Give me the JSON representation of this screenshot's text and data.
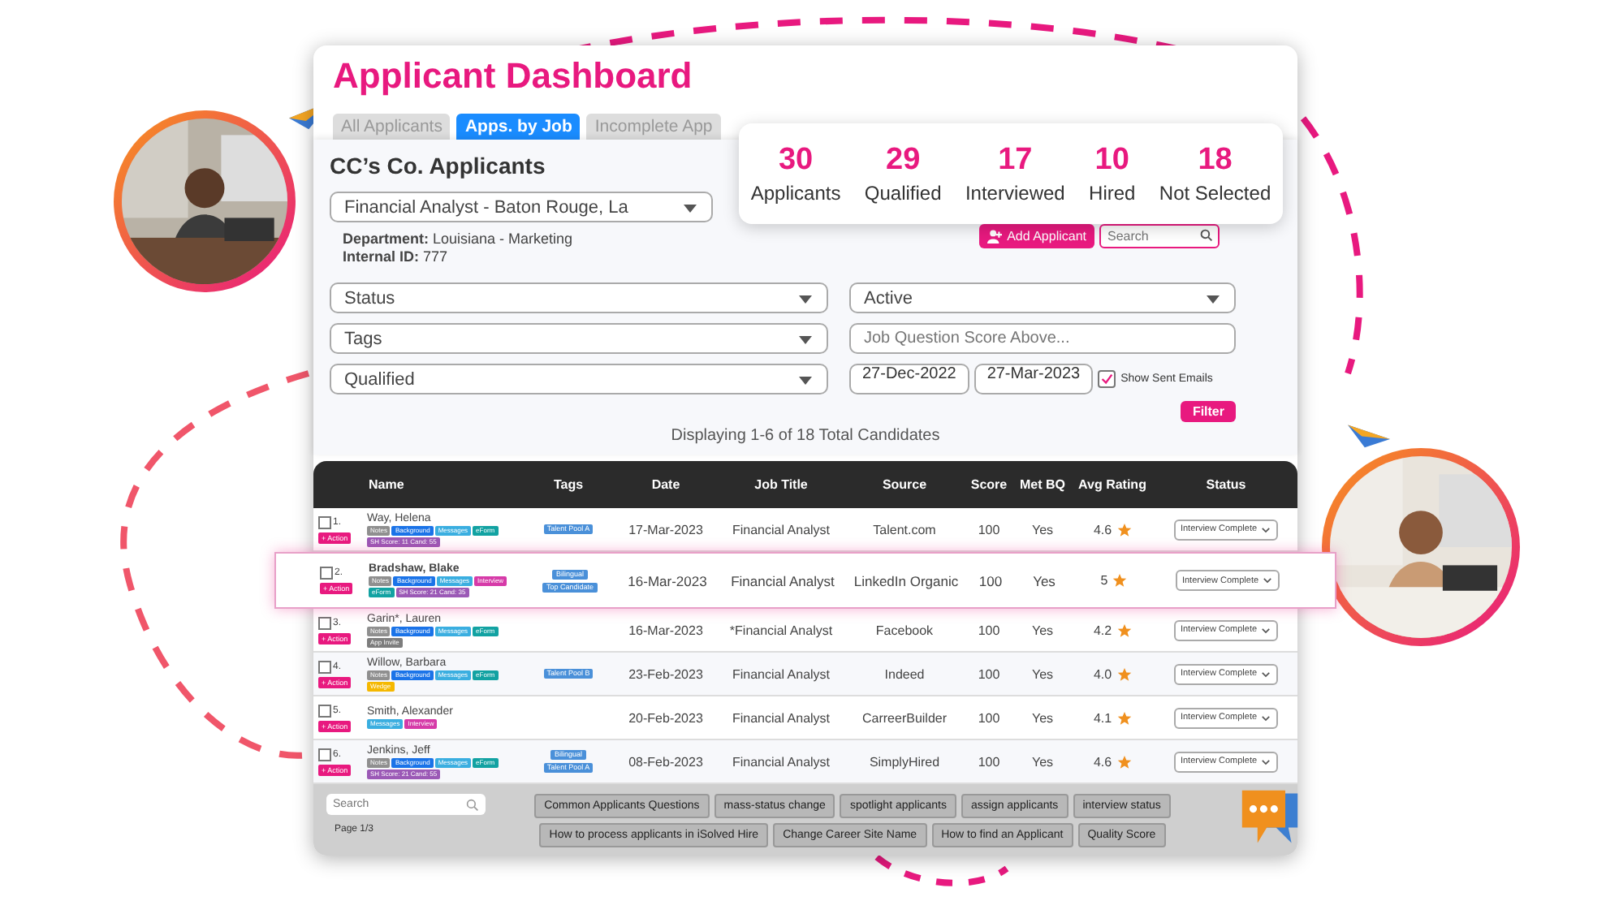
{
  "window": {
    "title": "Applicant Dashboard"
  },
  "tabs": [
    {
      "label": "All Applicants",
      "selected": false
    },
    {
      "label": "Apps. by Job",
      "selected": true
    },
    {
      "label": "Incomplete App",
      "selected": false
    }
  ],
  "stats": [
    {
      "value": "30",
      "label": "Applicants"
    },
    {
      "value": "29",
      "label": "Qualified"
    },
    {
      "value": "17",
      "label": "Interviewed"
    },
    {
      "value": "10",
      "label": "Hired"
    },
    {
      "value": "18",
      "label": "Not Selected"
    }
  ],
  "panel": {
    "title": "CC’s Co. Applicants",
    "job_select": "Financial Analyst - Baton Rouge, La",
    "department": "**Department:** Louisiana -  Marketing",
    "internal_id": "**Internal ID:** 777",
    "add_button": "Add Applicant",
    "search": {
      "placeholder": "Search"
    }
  },
  "filters": {
    "left": [
      "Status",
      "Tags",
      "Qualified"
    ],
    "state_select": "Active",
    "score_field": {
      "placeholder": "Job Question Score Above..."
    },
    "date_from": "27-Dec-2022",
    "date_to": "27-Mar-2023",
    "show_sent_emails": {
      "label": "Show Sent Emails",
      "checked": true
    },
    "filter_button": "Filter"
  },
  "summary": "Displaying 1-6 of 18 Total Candidates",
  "table": {
    "columns": [
      "Name",
      "Tags",
      "Date",
      "Job Title",
      "Source",
      "Score",
      "Met BQ",
      "Avg Rating",
      "Status"
    ],
    "rows": [
      {
        "number": "1.",
        "checked": false,
        "selected": false,
        "action": "+ Action",
        "name": "Way, Helena",
        "badges": [
          {
            "label": "Notes",
            "color": "#8f8f8f"
          },
          {
            "label": "Background",
            "color": "#1a73e8"
          },
          {
            "label": "Messages",
            "color": "#3aaee0"
          },
          {
            "label": "eForm",
            "color": "#12a2a2"
          },
          {
            "label": "SH Score: 11 Cand: 55",
            "color": "#9b59b6"
          }
        ],
        "tags": [
          "Talent Pool A"
        ],
        "date": "17-Mar-2023",
        "job_title": "Financial Analyst",
        "source": "Talent.com",
        "score": "100",
        "met_bq": "Yes",
        "rating": "4.6",
        "status": "Interview Complete"
      },
      {
        "number": "2.",
        "checked": false,
        "selected": true,
        "action": "+ Action",
        "name": "Bradshaw, Blake",
        "badges": [
          {
            "label": "Notes",
            "color": "#8f8f8f"
          },
          {
            "label": "Background",
            "color": "#1a73e8"
          },
          {
            "label": "Messages",
            "color": "#3aaee0"
          },
          {
            "label": "Interview",
            "color": "#d63aa8"
          },
          {
            "label": "eForm",
            "color": "#12a2a2"
          },
          {
            "label": "SH Score: 21 Cand: 35",
            "color": "#9b59b6"
          }
        ],
        "tags": [
          "Bilingual",
          "Top Candidate"
        ],
        "date": "16-Mar-2023",
        "job_title": "Financial Analyst",
        "source": "LinkedIn Organic",
        "score": "100",
        "met_bq": "Yes",
        "rating": "5",
        "status": "Interview Complete"
      },
      {
        "number": "3.",
        "checked": false,
        "selected": false,
        "action": "+ Action",
        "name": "Garin*, Lauren",
        "badges": [
          {
            "label": "Notes",
            "color": "#8f8f8f"
          },
          {
            "label": "Background",
            "color": "#1a73e8"
          },
          {
            "label": "Messages",
            "color": "#3aaee0"
          },
          {
            "label": "eForm",
            "color": "#12a2a2"
          },
          {
            "label": "App Invite",
            "color": "#7d7d7d"
          }
        ],
        "tags": [],
        "date": "16-Mar-2023",
        "job_title": "*Financial Analyst",
        "source": "Facebook",
        "score": "100",
        "met_bq": "Yes",
        "rating": "4.2",
        "status": "Interview Complete"
      },
      {
        "number": "4.",
        "checked": false,
        "selected": false,
        "action": "+ Action",
        "name": "Willow, Barbara",
        "badges": [
          {
            "label": "Notes",
            "color": "#8f8f8f"
          },
          {
            "label": "Background",
            "color": "#1a73e8"
          },
          {
            "label": "Messages",
            "color": "#3aaee0"
          },
          {
            "label": "eForm",
            "color": "#12a2a2"
          },
          {
            "label": "Wedge",
            "color": "#f5b800"
          }
        ],
        "tags": [
          "Talent Pool B"
        ],
        "date": "23-Feb-2023",
        "job_title": "Financial Analyst",
        "source": "Indeed",
        "score": "100",
        "met_bq": "Yes",
        "rating": "4.0",
        "status": "Interview Complete"
      },
      {
        "number": "5.",
        "checked": false,
        "selected": false,
        "action": "+ Action",
        "name": "Smith, Alexander",
        "badges": [
          {
            "label": "Messages",
            "color": "#3aaee0"
          },
          {
            "label": "Interview",
            "color": "#d63aa8"
          }
        ],
        "tags": [],
        "date": "20-Feb-2023",
        "job_title": "Financial Analyst",
        "source": "CarreerBuilder",
        "score": "100",
        "met_bq": "Yes",
        "rating": "4.1",
        "status": "Interview Complete"
      },
      {
        "number": "6.",
        "checked": false,
        "selected": false,
        "action": "+ Action",
        "name": "Jenkins, Jeff",
        "badges": [
          {
            "label": "Notes",
            "color": "#8f8f8f"
          },
          {
            "label": "Background",
            "color": "#1a73e8"
          },
          {
            "label": "Messages",
            "color": "#3aaee0"
          },
          {
            "label": "eForm",
            "color": "#12a2a2"
          },
          {
            "label": "SH Score: 21 Cand: 55",
            "color": "#9b59b6"
          }
        ],
        "tags": [
          "Bilingual",
          "Talent Pool A"
        ],
        "date": "08-Feb-2023",
        "job_title": "Financial Analyst",
        "source": "SimplyHired",
        "score": "100",
        "met_bq": "Yes",
        "rating": "4.6",
        "status": "Interview Complete"
      }
    ]
  },
  "footer": {
    "search": {
      "placeholder": "Search"
    },
    "page": "Page 1/3",
    "buttons": [
      "Common Applicants Questions",
      "mass-status change",
      "spotlight applicants",
      "assign applicants",
      "interview status",
      "How to process applicants in iSolved Hire",
      "Change Career Site Name",
      "How to find an Applicant",
      "Quality Score"
    ]
  }
}
